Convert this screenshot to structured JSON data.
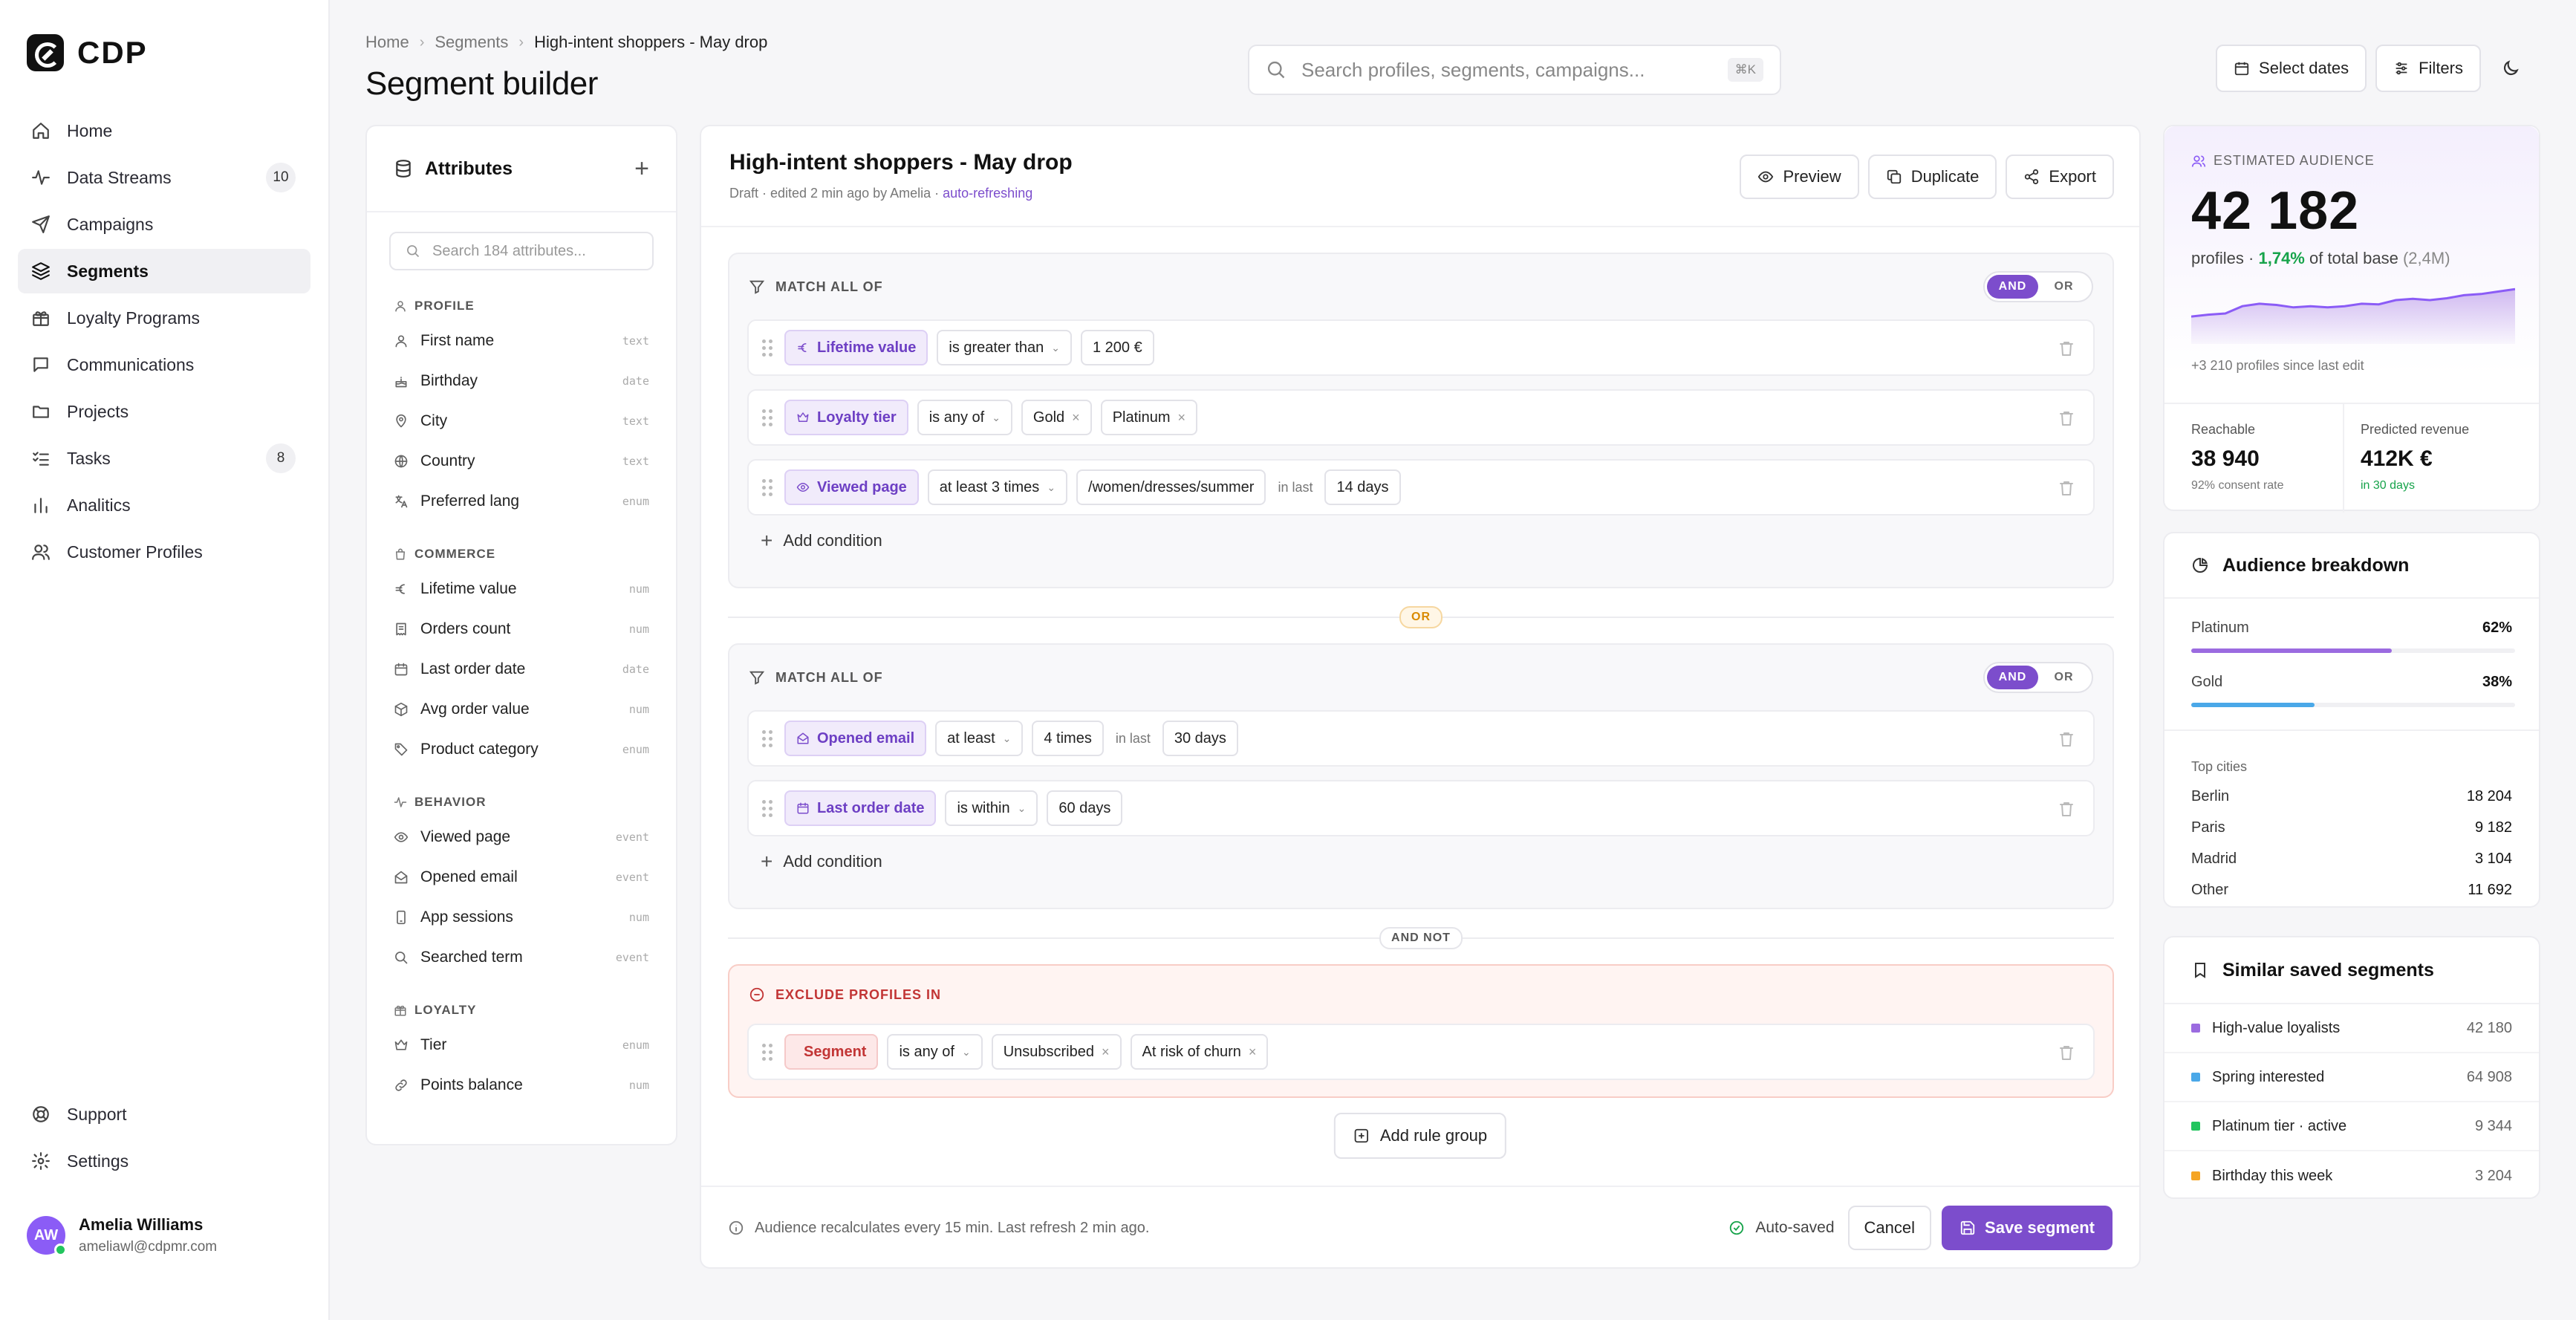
{
  "app": {
    "name": "CDP"
  },
  "nav": [
    {
      "label": "Home",
      "icon": "home-icon",
      "badge": ""
    },
    {
      "label": "Data Streams",
      "icon": "activity-icon",
      "badge": "10"
    },
    {
      "label": "Campaigns",
      "icon": "send-icon",
      "badge": ""
    },
    {
      "label": "Segments",
      "icon": "layers-icon",
      "badge": "",
      "active": true
    },
    {
      "label": "Loyalty Programs",
      "icon": "gift-icon",
      "badge": ""
    },
    {
      "label": "Communications",
      "icon": "message-icon",
      "badge": ""
    },
    {
      "label": "Projects",
      "icon": "folder-icon",
      "badge": ""
    },
    {
      "label": "Tasks",
      "icon": "tasks-icon",
      "badge": "8"
    },
    {
      "label": "Analitics",
      "icon": "bar-chart-icon",
      "badge": ""
    },
    {
      "label": "Customer Profiles",
      "icon": "users-icon",
      "badge": ""
    }
  ],
  "nav_bottom": [
    {
      "label": "Support",
      "icon": "lifebuoy-icon"
    },
    {
      "label": "Settings",
      "icon": "gear-icon"
    }
  ],
  "user": {
    "initials": "AW",
    "name": "Amelia Williams",
    "email": "ameliawl@cdpmr.com"
  },
  "breadcrumb": [
    "Home",
    "Segments",
    "High-intent shoppers - May drop"
  ],
  "page_title": "Segment builder",
  "search": {
    "placeholder": "Search profiles, segments, campaigns...",
    "shortcut": "⌘K"
  },
  "top_actions": {
    "dates": "Select dates",
    "filters": "Filters"
  },
  "attributes": {
    "title": "Attributes",
    "search_placeholder": "Search 184 attributes...",
    "sections": [
      {
        "name": "PROFILE",
        "items": [
          {
            "label": "First name",
            "type": "text"
          },
          {
            "label": "Birthday",
            "type": "date"
          },
          {
            "label": "City",
            "type": "text"
          },
          {
            "label": "Country",
            "type": "text"
          },
          {
            "label": "Preferred lang",
            "type": "enum"
          }
        ]
      },
      {
        "name": "COMMERCE",
        "items": [
          {
            "label": "Lifetime value",
            "type": "num"
          },
          {
            "label": "Orders count",
            "type": "num"
          },
          {
            "label": "Last order date",
            "type": "date"
          },
          {
            "label": "Avg order value",
            "type": "num"
          },
          {
            "label": "Product category",
            "type": "enum"
          }
        ]
      },
      {
        "name": "BEHAVIOR",
        "items": [
          {
            "label": "Viewed page",
            "type": "event"
          },
          {
            "label": "Opened email",
            "type": "event"
          },
          {
            "label": "App sessions",
            "type": "num"
          },
          {
            "label": "Searched term",
            "type": "event"
          }
        ]
      },
      {
        "name": "LOYALTY",
        "items": [
          {
            "label": "Tier",
            "type": "enum"
          },
          {
            "label": "Points balance",
            "type": "num"
          }
        ]
      }
    ]
  },
  "builder": {
    "title": "High-intent shoppers - May drop",
    "subtitle": "Draft · edited 2 min ago by Amelia · ",
    "live": "auto-refreshing",
    "actions": {
      "preview": "Preview",
      "duplicate": "Duplicate",
      "export": "Export"
    },
    "match_label": "MATCH ALL OF",
    "and": "AND",
    "or": "OR",
    "in_last": "in last",
    "add_condition": "Add condition",
    "group1": [
      {
        "attr": "Lifetime value",
        "op": "is greater than",
        "values": [
          "1 200 €"
        ]
      },
      {
        "attr": "Loyalty tier",
        "op": "is any of",
        "tags": [
          "Gold",
          "Platinum"
        ]
      },
      {
        "attr": "Viewed page",
        "op": "at least 3 times",
        "values": [
          "/women/dresses/summer"
        ],
        "last": "14 days"
      }
    ],
    "or_pill": "OR",
    "group2": [
      {
        "attr": "Opened email",
        "op": "at least",
        "values": [
          "4 times"
        ],
        "last": "30 days"
      },
      {
        "attr": "Last order date",
        "op": "is within",
        "values": [
          "60 days"
        ]
      }
    ],
    "andnot_pill": "AND NOT",
    "exclude_label": "EXCLUDE PROFILES IN",
    "exclude": {
      "attr": "Segment",
      "op": "is any of",
      "tags": [
        "Unsubscribed",
        "At risk of churn"
      ]
    },
    "add_group": "Add rule group",
    "footer_note": "Audience recalculates every 15 min. Last refresh 2 min ago.",
    "autosaved": "Auto-saved",
    "cancel": "Cancel",
    "save": "Save segment"
  },
  "audience": {
    "label": "ESTIMATED AUDIENCE",
    "count": "42 182",
    "profiles": "profiles · ",
    "pct": "1,74%",
    "of_total": " of total base ",
    "base": "(2,4M)",
    "trend": [
      0.45,
      0.48,
      0.5,
      0.62,
      0.66,
      0.64,
      0.6,
      0.62,
      0.6,
      0.62,
      0.66,
      0.65,
      0.72,
      0.74,
      0.72,
      0.75,
      0.8,
      0.82,
      0.86,
      0.9
    ],
    "since": "+3 210 profiles since last edit",
    "reachable_label": "Reachable",
    "reachable": "38 940",
    "consent": "92% consent rate",
    "revenue_label": "Predicted revenue",
    "revenue": "412K €",
    "revenue_note": "in 30 days"
  },
  "breakdown": {
    "title": "Audience breakdown",
    "tiers": [
      {
        "name": "Platinum",
        "pct": "62%",
        "value": 0.62,
        "color": "#9b6be0"
      },
      {
        "name": "Gold",
        "pct": "38%",
        "value": 0.38,
        "color": "#4aa8e8"
      }
    ],
    "cities_label": "Top cities",
    "cities": [
      {
        "name": "Berlin",
        "value": "18 204"
      },
      {
        "name": "Paris",
        "value": "9 182"
      },
      {
        "name": "Madrid",
        "value": "3 104"
      },
      {
        "name": "Other",
        "value": "11 692"
      }
    ]
  },
  "similar": {
    "title": "Similar saved segments",
    "items": [
      {
        "name": "High-value loyalists",
        "count": "42 180",
        "color": "#9b6be0"
      },
      {
        "name": "Spring interested",
        "count": "64 908",
        "color": "#4aa8e8"
      },
      {
        "name": "Platinum tier · active",
        "count": "9 344",
        "color": "#22c55e"
      },
      {
        "name": "Birthday this week",
        "count": "3 204",
        "color": "#f5a524"
      }
    ]
  }
}
